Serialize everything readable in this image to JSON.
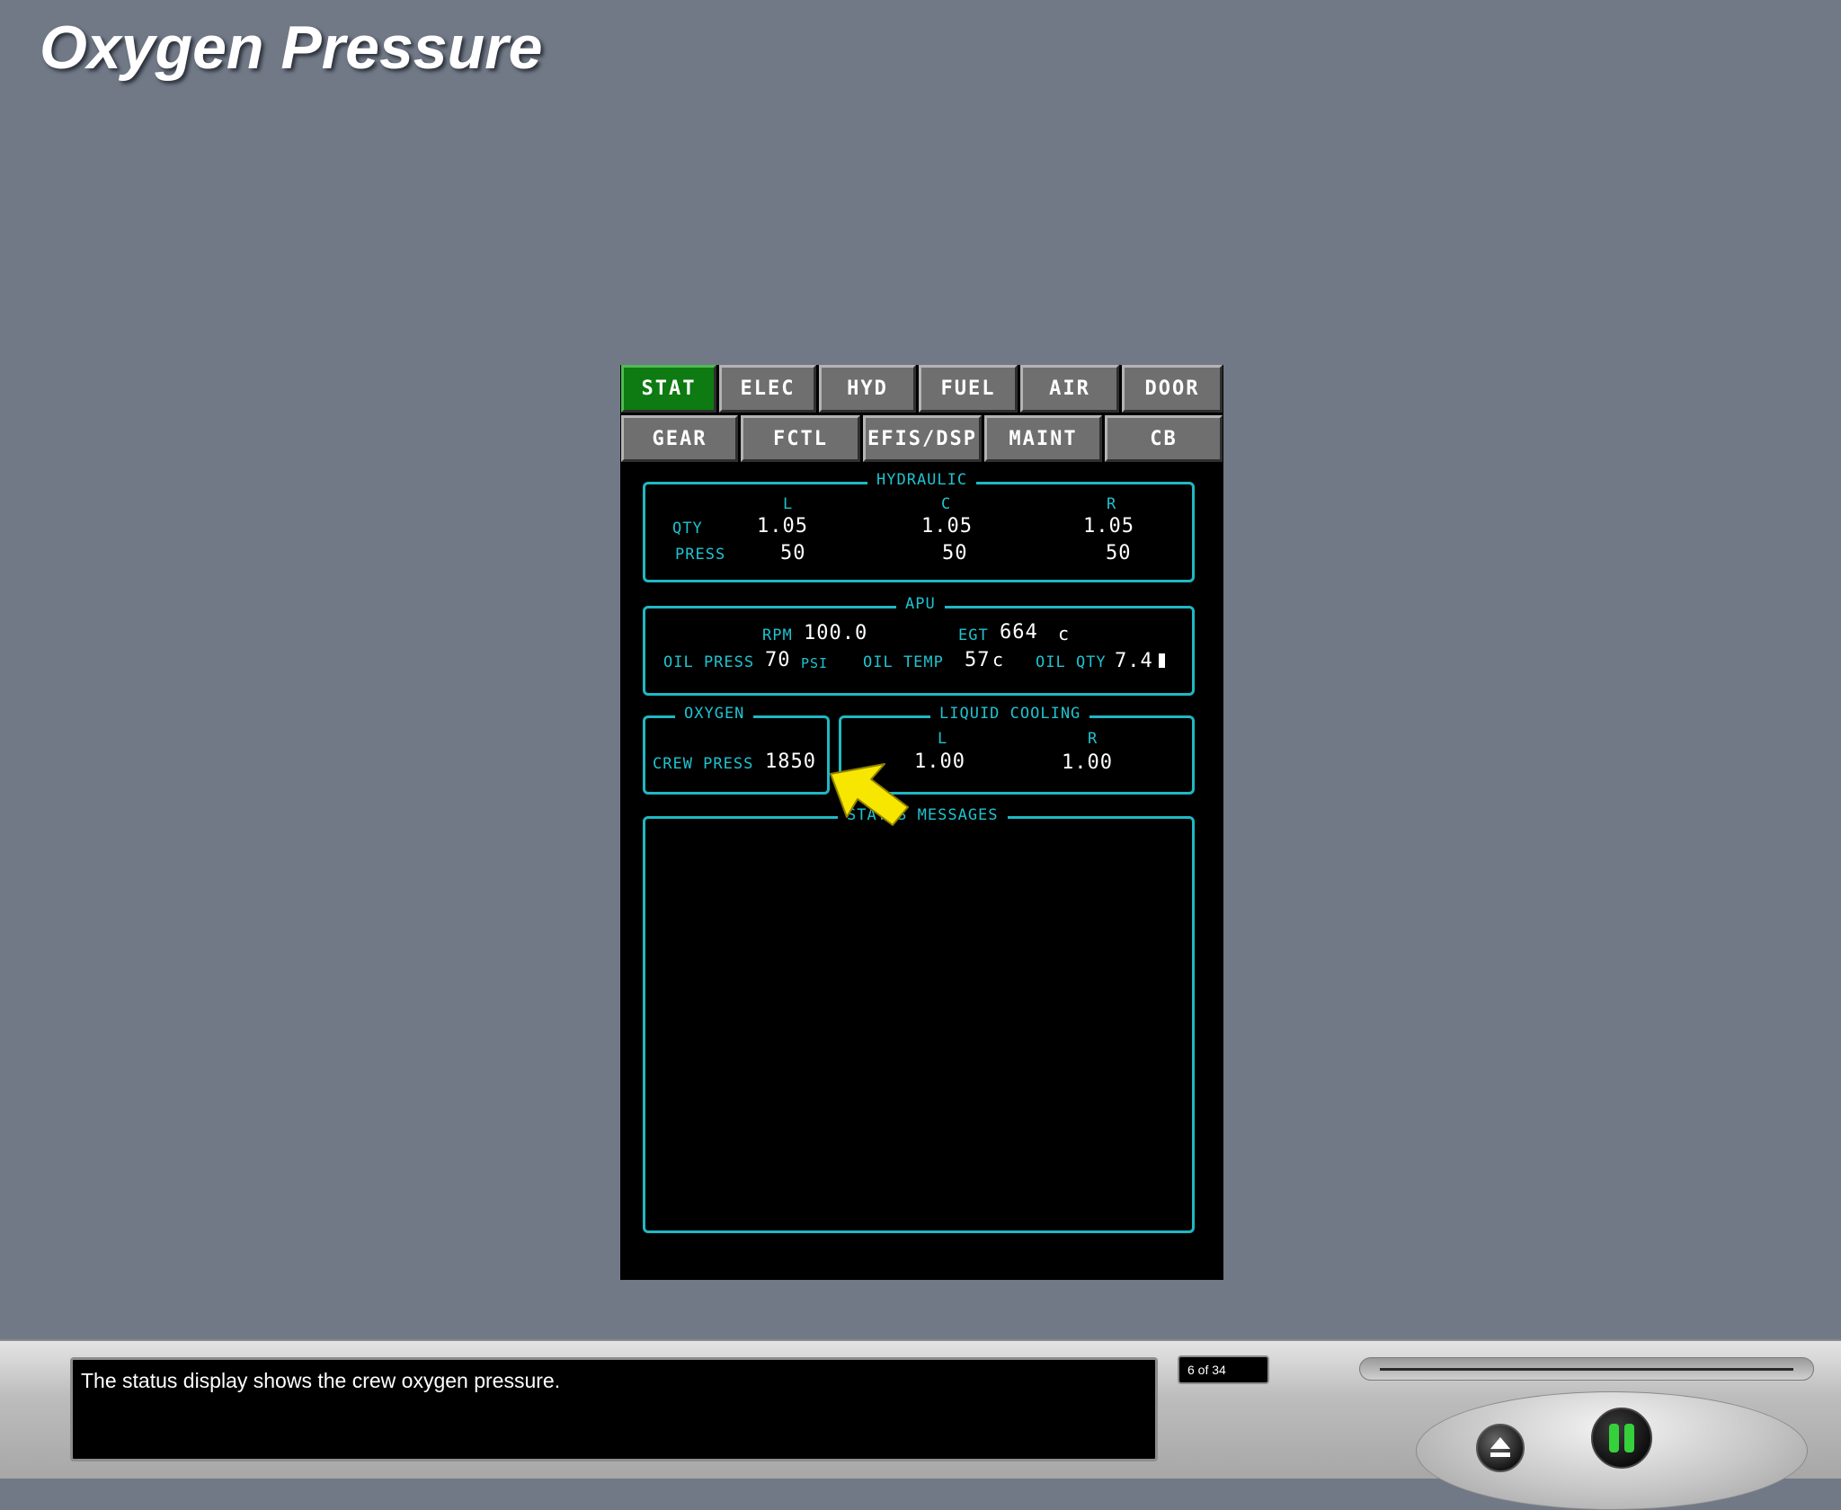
{
  "page": {
    "title": "Oxygen Pressure"
  },
  "tabs_row1": [
    "STAT",
    "ELEC",
    "HYD",
    "FUEL",
    "AIR",
    "DOOR"
  ],
  "tabs_row2": [
    "GEAR",
    "FCTL",
    "EFIS/DSP",
    "MAINT",
    "CB"
  ],
  "active_tab": "STAT",
  "hydraulic": {
    "title": "HYDRAULIC",
    "col_labels": {
      "l": "L",
      "c": "C",
      "r": "R"
    },
    "qty_label": "QTY",
    "press_label": "PRESS",
    "qty": {
      "l": "1.05",
      "c": "1.05",
      "r": "1.05"
    },
    "press": {
      "l": "50",
      "c": "50",
      "r": "50"
    }
  },
  "apu": {
    "title": "APU",
    "rpm_label": "RPM",
    "rpm": "100.0",
    "egt_label": "EGT",
    "egt": "664",
    "egt_unit": "c",
    "oil_press_label": "OIL PRESS",
    "oil_press": "70",
    "oil_press_unit": "PSI",
    "oil_temp_label": "OIL TEMP",
    "oil_temp": "57",
    "oil_temp_unit": "c",
    "oil_qty_label": "OIL QTY",
    "oil_qty": "7.4"
  },
  "oxygen": {
    "title": "OXYGEN",
    "crew_press_label": "CREW PRESS",
    "crew_press": "1850"
  },
  "liquid_cooling": {
    "title": "LIQUID COOLING",
    "col_labels": {
      "l": "L",
      "r": "R"
    },
    "values": {
      "l": "1.00",
      "r": "1.00"
    }
  },
  "status_messages": {
    "title": "STATUS MESSAGES"
  },
  "player": {
    "caption": "The status display shows the crew oxygen pressure.",
    "counter": "6 of 34",
    "progress": 1.0,
    "eject_icon": "eject-icon",
    "pause_icon": "pause-icon"
  },
  "colors": {
    "background": "#717987",
    "display_cyan": "#1fc3cf",
    "active_tab": "#0e7a12",
    "pointer": "#f7e600"
  }
}
